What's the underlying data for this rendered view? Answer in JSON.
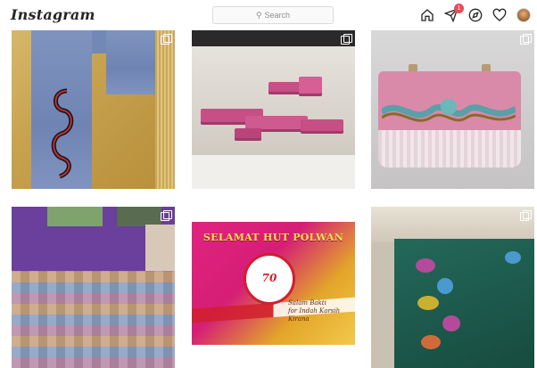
{
  "app": {
    "logo": "Instagram"
  },
  "search": {
    "placeholder": "Search"
  },
  "nav": {
    "items": [
      {
        "name": "home",
        "icon": "home-icon"
      },
      {
        "name": "direct",
        "icon": "paper-plane-icon",
        "badge": "1"
      },
      {
        "name": "explore",
        "icon": "compass-icon"
      },
      {
        "name": "activity",
        "icon": "heart-icon"
      },
      {
        "name": "profile",
        "icon": "avatar"
      }
    ]
  },
  "grid": {
    "posts": [
      {
        "subject": "embroidered jeans on woven rug",
        "multi": true
      },
      {
        "subject": "pink decorated trays",
        "multi": true
      },
      {
        "subject": "pink embroidered handbag",
        "multi": true
      },
      {
        "subject": "knitted patchwork blanket",
        "multi": true
      },
      {
        "subject": "greeting card",
        "multi": true,
        "card": {
          "headline": "SELAMAT HUT POLWAN",
          "emblem": "70",
          "script_line1": "Salam Bakti",
          "script_line2": "for Indah Karsih Kirana"
        }
      },
      {
        "subject": "embroidered green fabric",
        "multi": true
      }
    ]
  },
  "colors": {
    "badge": "#ed4956",
    "text": "#262626",
    "border": "#dbdbdb"
  }
}
